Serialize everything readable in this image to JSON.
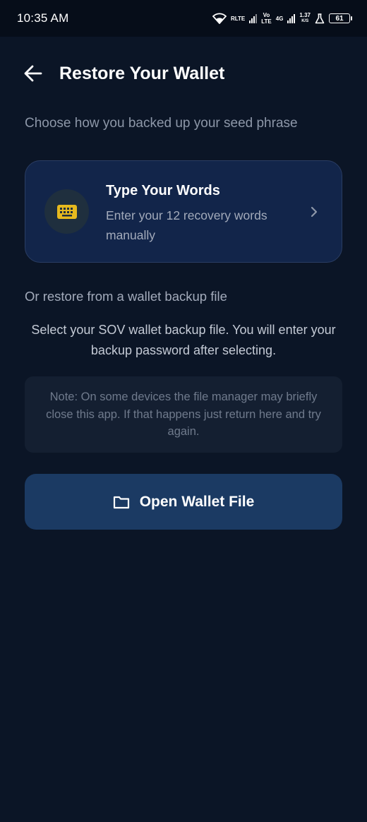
{
  "status_bar": {
    "time": "10:35 AM",
    "network_1": "RLTE",
    "network_2_top": "Vo",
    "network_2_bottom": "LTE",
    "network_3": "4G",
    "speed_value": "1.37",
    "speed_unit": "K/S",
    "battery": "61"
  },
  "header": {
    "title": "Restore Your Wallet",
    "back_icon": "arrow-left-icon"
  },
  "subtitle": "Choose how you backed up your seed phrase",
  "type_card": {
    "title": "Type Your Words",
    "description": "Enter your 12 recovery words manually",
    "icon": "keyboard-icon",
    "icon_color": "#e6b91e"
  },
  "restore_section": {
    "label": "Or restore from a wallet backup file",
    "description": "Select your SOV wallet backup file. You will enter your backup password after selecting.",
    "note": "Note: On some devices the file manager may briefly close this app. If that happens just return here and try again."
  },
  "open_button": {
    "label": "Open Wallet File",
    "icon": "folder-icon"
  },
  "colors": {
    "background": "#0b1526",
    "card": "#12254a",
    "button": "#1b3a63",
    "accent": "#e6b91e"
  }
}
